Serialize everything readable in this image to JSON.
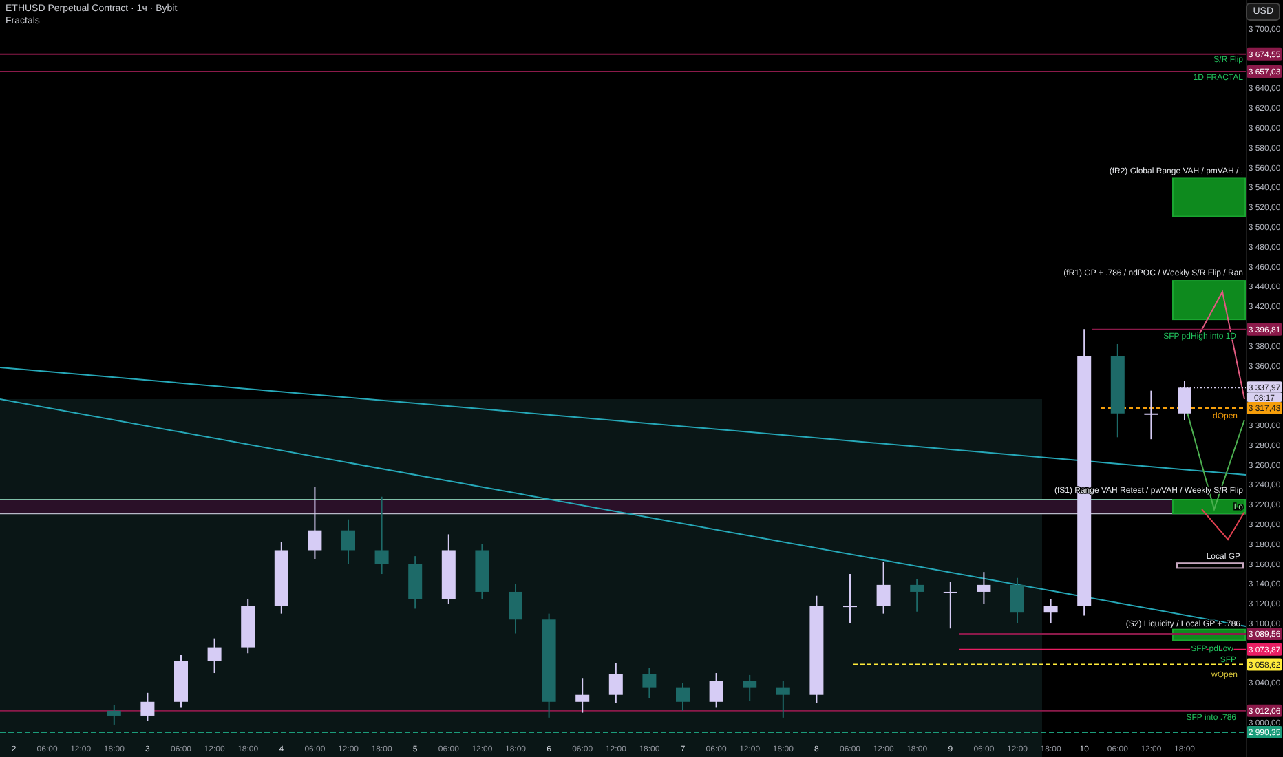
{
  "header": {
    "title": "ETHUSD Perpetual Contract · 1ч · Bybit",
    "indicator": "Fractals"
  },
  "currency_button": "USD",
  "countdown": "08:17",
  "chart_data": {
    "type": "candlestick",
    "ylim": [
      2965.3,
      3729.2
    ],
    "categories": [
      "2",
      "06:00",
      "12:00",
      "18:00",
      "3",
      "06:00",
      "12:00",
      "18:00",
      "4",
      "06:00",
      "12:00",
      "18:00",
      "5",
      "06:00",
      "12:00",
      "18:00",
      "6",
      "06:00",
      "12:00",
      "18:00",
      "7",
      "06:00",
      "12:00",
      "18:00",
      "8",
      "06:00",
      "12:00",
      "18:00",
      "9",
      "06:00",
      "12:00",
      "18:00",
      "10",
      "06:00",
      "12:00",
      "18:00"
    ],
    "series": [
      {
        "color": "#d6ccf5",
        "ohlc": [
          null,
          null,
          null,
          null,
          [
            3007,
            3030,
            3002,
            3021
          ],
          [
            3021,
            3068,
            3015,
            3062
          ],
          [
            3062,
            3085,
            3050,
            3076
          ],
          [
            3076,
            3125,
            3070,
            3118
          ],
          [
            3118,
            3182,
            3110,
            3174
          ],
          [
            3174,
            3238,
            3165,
            3194
          ],
          null,
          null,
          null,
          [
            3125,
            3190,
            3120,
            3174
          ],
          null,
          null,
          null,
          [
            3021,
            3045,
            3010,
            3028
          ],
          [
            3028,
            3060,
            3020,
            3049
          ],
          null,
          null,
          [
            3021,
            3050,
            3015,
            3042
          ],
          null,
          null,
          [
            3028,
            3128,
            3020,
            3118
          ],
          [
            3118,
            3150,
            3100,
            3118
          ],
          [
            3118,
            3162,
            3110,
            3139
          ],
          null,
          [
            3132,
            3142,
            3095,
            3132
          ],
          [
            3132,
            3152,
            3120,
            3139
          ],
          null,
          [
            3111,
            3125,
            3100,
            3118
          ],
          [
            3118,
            3397,
            3108,
            3370
          ],
          null,
          [
            3312,
            3335,
            3286,
            3312
          ],
          [
            3312,
            3345,
            3305,
            3338
          ]
        ]
      },
      {
        "color": "#1d6a68",
        "ohlc": [
          null,
          null,
          null,
          [
            3012,
            3018,
            2998,
            3007
          ],
          null,
          null,
          null,
          null,
          null,
          null,
          [
            3194,
            3205,
            3160,
            3174
          ],
          [
            3174,
            3228,
            3150,
            3160
          ],
          [
            3160,
            3168,
            3115,
            3125
          ],
          null,
          [
            3174,
            3180,
            3125,
            3132
          ],
          [
            3132,
            3140,
            3090,
            3104
          ],
          [
            3104,
            3110,
            3005,
            3021
          ],
          null,
          null,
          [
            3049,
            3055,
            3025,
            3035
          ],
          [
            3035,
            3040,
            3012,
            3021
          ],
          null,
          [
            3042,
            3048,
            3022,
            3035
          ],
          [
            3035,
            3042,
            3005,
            3028
          ],
          null,
          null,
          null,
          [
            3139,
            3145,
            3112,
            3132
          ],
          null,
          null,
          [
            3139,
            3146,
            3100,
            3111
          ],
          null,
          null,
          [
            3370,
            3382,
            3288,
            3312
          ],
          null,
          null
        ]
      }
    ],
    "yticks": [
      {
        "value": 3700,
        "label": "3 700,00"
      },
      {
        "value": 3640,
        "label": "3 640,00"
      },
      {
        "value": 3620,
        "label": "3 620,00"
      },
      {
        "value": 3600,
        "label": "3 600,00"
      },
      {
        "value": 3580,
        "label": "3 580,00"
      },
      {
        "value": 3560,
        "label": "3 560,00"
      },
      {
        "value": 3540,
        "label": "3 540,00"
      },
      {
        "value": 3520,
        "label": "3 520,00"
      },
      {
        "value": 3500,
        "label": "3 500,00"
      },
      {
        "value": 3480,
        "label": "3 480,00"
      },
      {
        "value": 3460,
        "label": "3 460,00"
      },
      {
        "value": 3440,
        "label": "3 440,00"
      },
      {
        "value": 3420,
        "label": "3 420,00"
      },
      {
        "value": 3380,
        "label": "3 380,00"
      },
      {
        "value": 3360,
        "label": "3 360,00"
      },
      {
        "value": 3300,
        "label": "3 300,00"
      },
      {
        "value": 3280,
        "label": "3 280,00"
      },
      {
        "value": 3260,
        "label": "3 260,00"
      },
      {
        "value": 3240,
        "label": "3 240,00"
      },
      {
        "value": 3220,
        "label": "3 220,00"
      },
      {
        "value": 3200,
        "label": "3 200,00"
      },
      {
        "value": 3180,
        "label": "3 180,00"
      },
      {
        "value": 3160,
        "label": "3 160,00"
      },
      {
        "value": 3140,
        "label": "3 140,00"
      },
      {
        "value": 3120,
        "label": "3 120,00"
      },
      {
        "value": 3100,
        "label": "3 100,00"
      },
      {
        "value": 3040,
        "label": "3 040,00"
      },
      {
        "value": 3000,
        "label": "3 000,00"
      }
    ],
    "ref_lines": [
      {
        "axis": "y",
        "value": 3674.55,
        "label": "3 674,55",
        "color": "#8b1a4a"
      },
      {
        "axis": "y",
        "value": 3657.03,
        "label": "3 657,03",
        "color": "#8b1a4a"
      },
      {
        "axis": "y",
        "value": 3396.81,
        "label": "3 396,81",
        "color": "#8b1a4a"
      },
      {
        "axis": "y",
        "value": 3337.97,
        "label": "3 337,97",
        "color": "#d8d0f0"
      },
      {
        "axis": "y",
        "value": 3317.43,
        "label": "3 317,43",
        "color": "#f59e0b"
      },
      {
        "axis": "y",
        "value": 3089.56,
        "label": "3 089,56",
        "color": "#8b1a4a"
      },
      {
        "axis": "y",
        "value": 3073.87,
        "label": "3 073,87",
        "color": "#e91e63"
      },
      {
        "axis": "y",
        "value": 3058.62,
        "label": "3 058,62",
        "color": "#ffeb3b"
      },
      {
        "axis": "y",
        "value": 3012.06,
        "label": "3 012,06",
        "color": "#8b1a4a"
      },
      {
        "axis": "y",
        "value": 2990.35,
        "label": "2 990,35",
        "color": "#1b9c7a"
      }
    ],
    "annotations": [
      "S/R Flip",
      "1D FRACTAL",
      "(fR2) Global Range VAH / pmVAH / ,",
      "(fR1) GP + .786 / ndPOC / Weekly S/R Flip / Ran",
      "SFP pdHigh into 1D",
      "dOpen",
      "(fS1) Range VAH Retest / pwVAH / Weekly S/R Flip",
      "Lo",
      "Local GP",
      "(S2) Liquidity / Local GP + .786",
      "SFP pdLow",
      "SFP",
      "wOpen",
      "SFP into .786"
    ]
  }
}
